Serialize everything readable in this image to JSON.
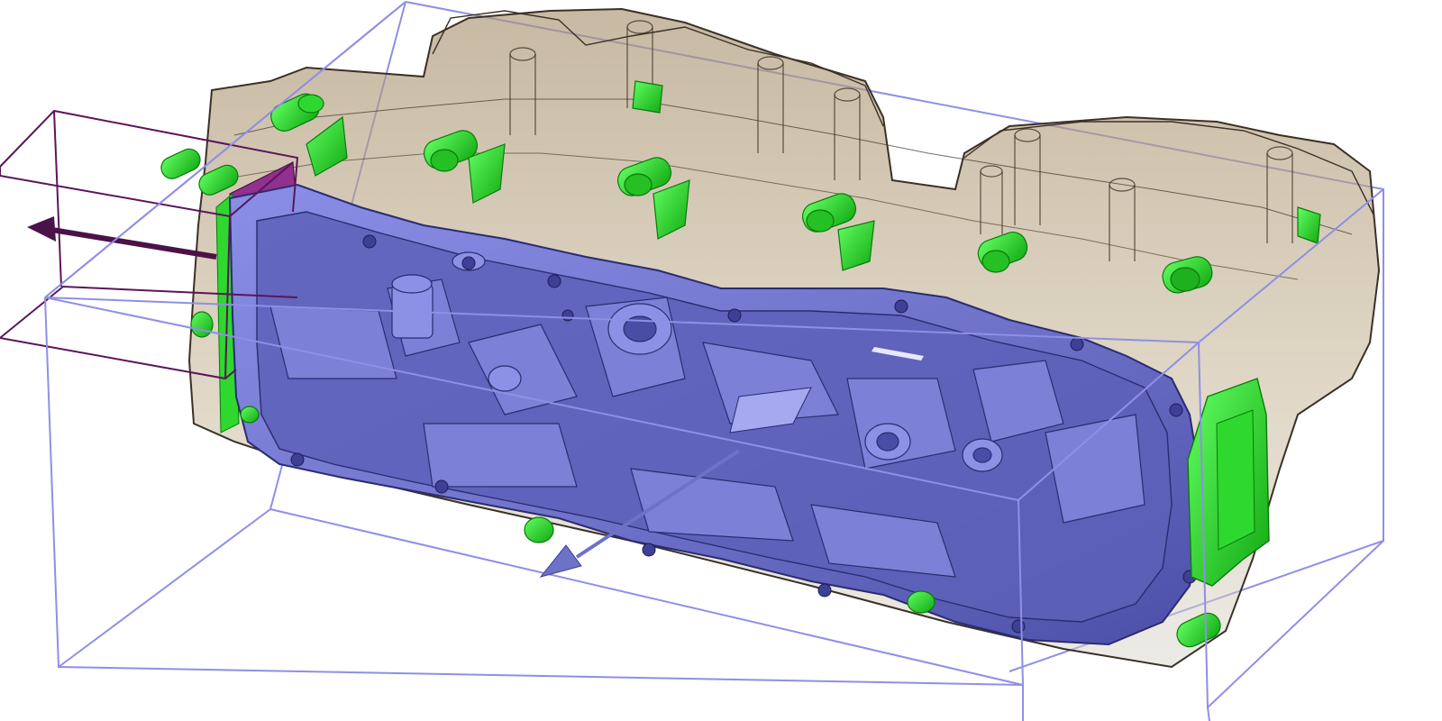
{
  "viewport": {
    "background": "#ffffff",
    "mode": "3d-cad-view"
  },
  "colors": {
    "cavity_bounding_box": "#8f8fe6",
    "core_bounding_box": "#5c1559",
    "translucent_housing": "#9c8763",
    "translucent_housing_edge": "#3a3126",
    "cover_part": "#6f72c9",
    "cover_part_dark": "#4a4da6",
    "highlighted_bosses": "#2ed82e",
    "highlighted_boss_dark": "#109a10",
    "pull_direction_arrow": "#6d72c7",
    "side_action_arrow": "#4b1249",
    "side_face_highlight": "#8a1f8a"
  },
  "icons": {
    "pull_direction": "arrow-down-left-icon",
    "side_action": "arrow-left-icon"
  }
}
